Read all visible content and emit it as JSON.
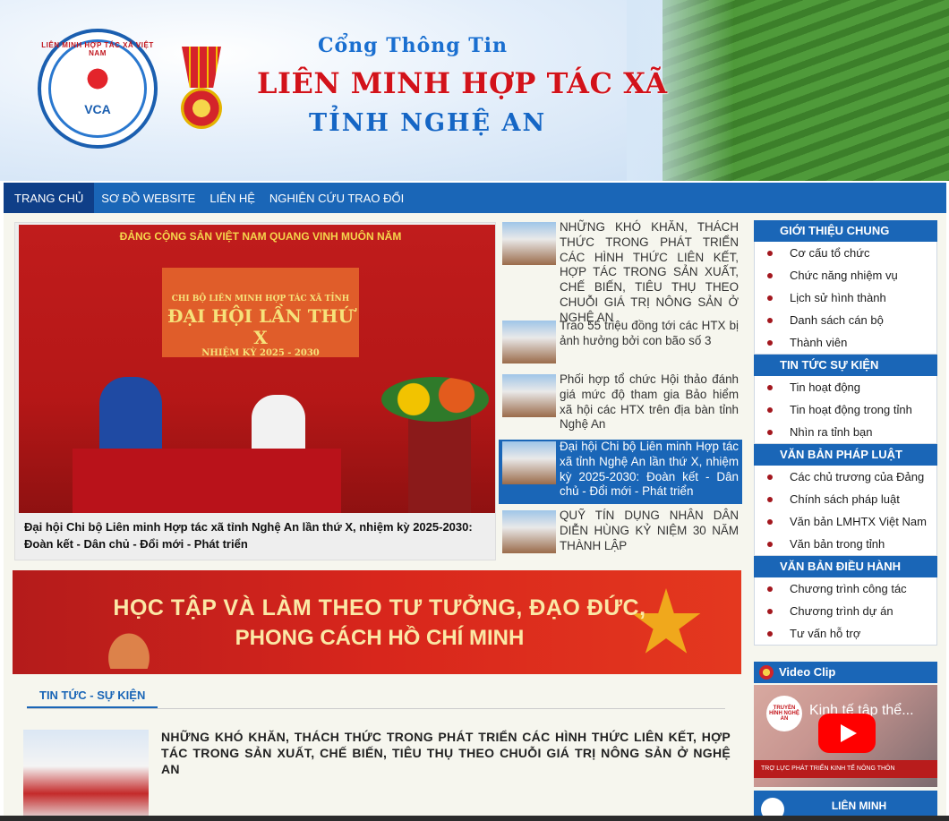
{
  "header": {
    "logo_text": "LIÊN MINH HỢP TÁC XÃ VIỆT NAM",
    "logo_abbr": "VCA",
    "title_line1": "Cổng Thông Tin",
    "title_line2": "LIÊN MINH HỢP TÁC XÃ",
    "title_line3": "TỈNH NGHỆ AN"
  },
  "nav": {
    "items": [
      {
        "label": "TRANG CHỦ",
        "active": true
      },
      {
        "label": "SƠ ĐỒ WEBSITE",
        "active": false
      },
      {
        "label": "LIÊN HỆ",
        "active": false
      },
      {
        "label": "NGHIÊN CỨU TRAO ĐỔI",
        "active": false
      }
    ]
  },
  "featured": {
    "photo_banner": "ĐẢNG CỘNG SẢN VIỆT NAM QUANG VINH MUÔN NĂM",
    "stage_line1": "CHI BỘ LIÊN MINH HỢP TÁC XÃ TỈNH",
    "stage_line2": "ĐẠI HỘI LẦN THỨ X",
    "stage_line3": "NHIỆM KỲ 2025 - 2030",
    "caption": "Đại hội Chi bộ Liên minh Hợp tác xã tỉnh Nghệ An lần thứ X, nhiệm kỳ 2025-2030: Đoàn kết - Dân chủ - Đổi mới - Phát triển"
  },
  "news_list": [
    {
      "title": "NHỮNG KHÓ KHĂN, THÁCH THỨC TRONG PHÁT TRIỂN CÁC HÌNH THỨC LIÊN KẾT, HỢP TÁC TRONG SẢN XUẤT, CHẾ BIẾN, TIÊU THỤ THEO CHUỖI GIÁ TRỊ NÔNG SẢN Ở NGHỆ AN",
      "selected": false
    },
    {
      "title": "Trao 55 triệu đồng tới các HTX bị ảnh hưởng bởi con bão số 3",
      "selected": false
    },
    {
      "title": "Phối hợp tổ chức Hội thảo đánh giá mức độ tham gia Bảo hiểm xã hội các HTX trên địa bàn tỉnh Nghệ An",
      "selected": false
    },
    {
      "title": "Đại hội Chi bộ Liên minh Hợp tác xã tỉnh Nghệ An lần thứ X, nhiệm kỳ 2025-2030: Đoàn kết - Dân chủ - Đổi mới - Phát triển",
      "selected": true
    },
    {
      "title": "QUỸ TÍN DỤNG NHÂN DÂN DIỄN HÙNG KỶ NIỆM 30 NĂM THÀNH LẬP",
      "selected": false
    }
  ],
  "sidebar": {
    "sections": [
      {
        "heading": "GIỚI THIỆU CHUNG",
        "items": [
          "Cơ cấu tổ chức",
          "Chức năng nhiệm vụ",
          "Lịch sử hình thành",
          "Danh sách cán bộ",
          "Thành viên"
        ]
      },
      {
        "heading": "TIN TỨC SỰ KIỆN",
        "items": [
          "Tin hoạt động",
          "Tin hoạt động trong tỉnh",
          "Nhìn ra tỉnh bạn"
        ]
      },
      {
        "heading": "VĂN BẢN PHÁP LUẬT",
        "items": [
          "Các chủ trương của Đảng",
          "Chính sách pháp luật",
          "Văn bản LMHTX Việt Nam",
          "Văn bản trong tỉnh"
        ]
      },
      {
        "heading": "VĂN BẢN ĐIỀU HÀNH",
        "items": [
          "Chương trình công tác",
          "Chương trình dự án",
          "Tư vấn hỗ trợ"
        ]
      }
    ]
  },
  "promo": {
    "line1": "HỌC TẬP VÀ LÀM THEO TƯ TƯỞNG, ĐẠO ĐỨC,",
    "line2": "PHONG CÁCH HỒ CHÍ MINH"
  },
  "section": {
    "tab_label": "TIN TỨC - SỰ KIỆN",
    "lead_title": "NHỮNG KHÓ KHĂN, THÁCH THỨC TRONG PHÁT TRIỂN CÁC HÌNH THỨC LIÊN KẾT, HỢP TÁC TRONG SẢN XUẤT, CHẾ BIẾN, TIÊU THỤ THEO CHUỖI GIÁ TRỊ NÔNG SẢN Ở NGHỆ AN"
  },
  "video": {
    "heading": "Video Clip",
    "title": "Kinh tế tập thể...",
    "channel": "TRUYỀN HÌNH NGHỆ AN",
    "strip": "TRỢ LỰC PHÁT TRIỂN KINH TẾ NÔNG THÔN"
  },
  "bottom_box": {
    "label": "LIÊN MINH"
  },
  "colors": {
    "nav_blue": "#1a66b7",
    "nav_active": "#0f3f88",
    "bullet": "#a3171e",
    "promo_red": "#d8261c"
  }
}
